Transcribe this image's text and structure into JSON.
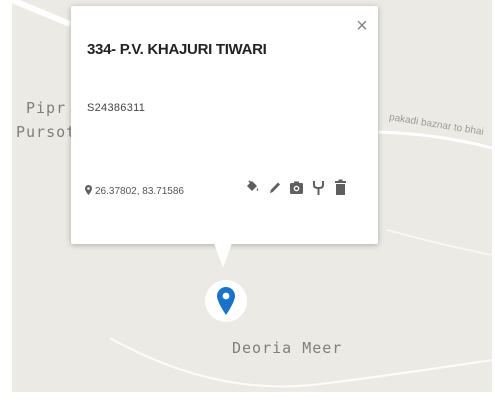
{
  "map": {
    "place_labels": {
      "pipr": "Pipr",
      "pursot": "Pursot",
      "deoria": "Deoria Meer"
    },
    "road_label": "pakadi baznar to bhai"
  },
  "popup": {
    "title": "334- P.V. KHAJURI TIWARI",
    "phone": "S24386311",
    "coordinates": "26.37802, 83.71586",
    "close_glyph": "×",
    "actions": [
      "paint-bucket-icon",
      "pencil-icon",
      "camera-icon",
      "fork-icon",
      "trash-icon"
    ]
  },
  "colors": {
    "map_bg": "#eceae4",
    "marker": "#1a73c8",
    "icon": "#5f5f5f"
  }
}
